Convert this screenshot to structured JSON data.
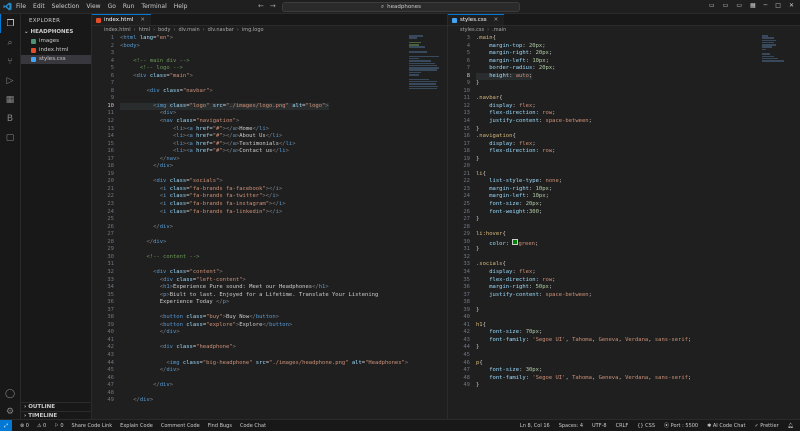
{
  "titlebar": {
    "menu": [
      "File",
      "Edit",
      "Selection",
      "View",
      "Go",
      "Run",
      "Terminal",
      "Help"
    ],
    "search": "headphones"
  },
  "sidebar": {
    "title": "EXPLORER",
    "folder": "HEADPHONES",
    "files": [
      {
        "name": "images",
        "color": "#4d9375"
      },
      {
        "name": "index.html",
        "color": "#e44d26"
      },
      {
        "name": "styles.css",
        "color": "#42a5f5"
      }
    ],
    "outline": "OUTLINE",
    "timeline": "TIMELINE"
  },
  "left_editor": {
    "tab": "index.html",
    "crumbs": [
      "index.html",
      "html",
      "body",
      "div.main",
      "div.navbar",
      "img.logo"
    ]
  },
  "right_editor": {
    "tab": "styles.css",
    "crumbs": [
      "styles.css",
      ".main"
    ]
  },
  "statusbar": {
    "left": [
      "0",
      "0",
      "0",
      "Share Code Link",
      "Explain Code",
      "Comment Code",
      "Find Bugs",
      "Code Chat"
    ],
    "right": [
      "Ln 8, Col 16",
      "Spaces: 4",
      "UTF-8",
      "CRLF",
      "CSS",
      "Port : 5500",
      "AI Code Chat",
      "Prettier"
    ]
  }
}
